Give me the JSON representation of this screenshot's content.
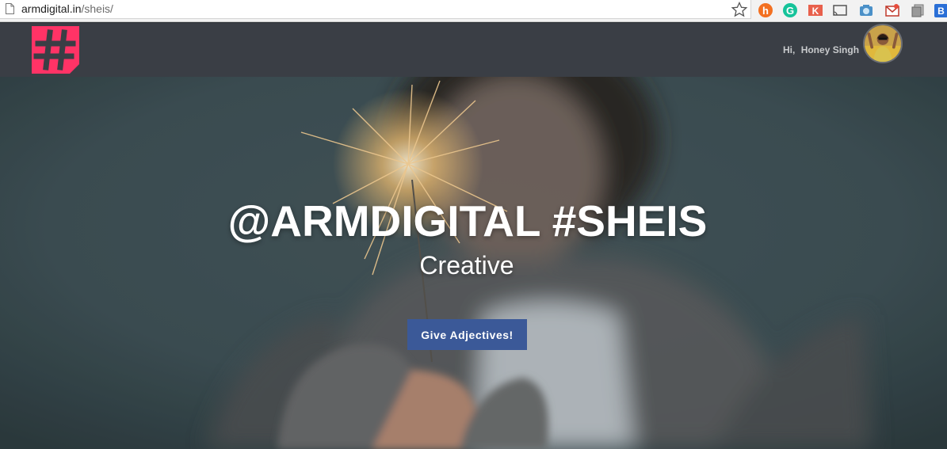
{
  "browser": {
    "url_host": "armdigital.in",
    "url_path": "/sheis/",
    "extensions": [
      "honey-icon",
      "grammarly-icon",
      "kk-icon",
      "cast-icon",
      "camera-icon",
      "mail-icon",
      "copy-icon",
      "bookmark-icon"
    ]
  },
  "header": {
    "greeting": "Hi,",
    "user_name": "Honey Singh",
    "logo": "hashtag-logo"
  },
  "hero": {
    "title": "@ARMDIGITAL #SHEIS",
    "subtitle": "Creative",
    "button_label": "Give Adjectives!"
  },
  "colors": {
    "header_bg": "#3a3e45",
    "logo": "#ff3366",
    "button": "#3b5998"
  }
}
